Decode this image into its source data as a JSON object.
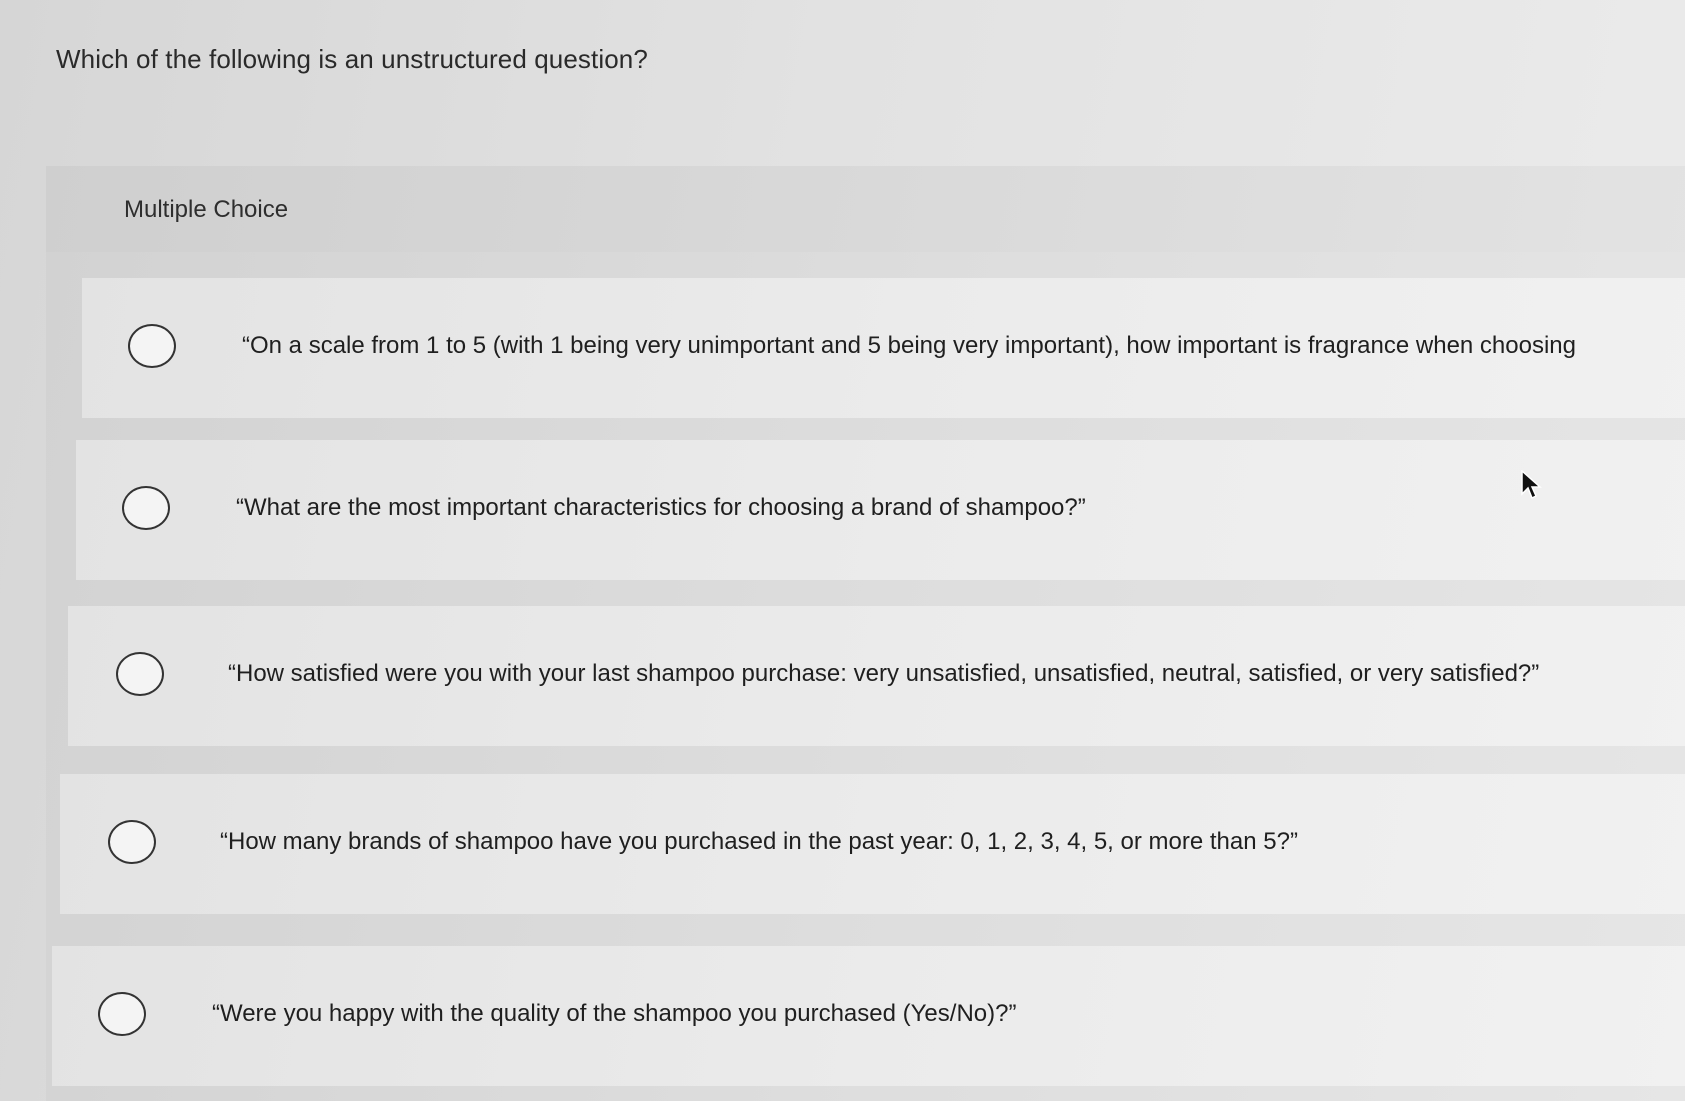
{
  "question": {
    "text": "Which of the following is an unstructured question?"
  },
  "multiple_choice": {
    "label": "Multiple Choice",
    "options": [
      {
        "label": "“On a scale from 1 to 5 (with 1 being very unimportant and 5 being very important), how important is fragrance when choosing",
        "selected": false
      },
      {
        "label": "“What are the most important characteristics for choosing a brand of shampoo?”",
        "selected": false
      },
      {
        "label": "“How satisfied were you with your last shampoo purchase: very unsatisfied, unsatisfied, neutral, satisfied, or very satisfied?”",
        "selected": false
      },
      {
        "label": "“How many brands of shampoo have you purchased in the past year: 0, 1, 2, 3, 4, 5, or more than 5?”",
        "selected": false
      },
      {
        "label": "“Were you happy with the quality of the shampoo you purchased (Yes/No)?”",
        "selected": false
      }
    ]
  }
}
